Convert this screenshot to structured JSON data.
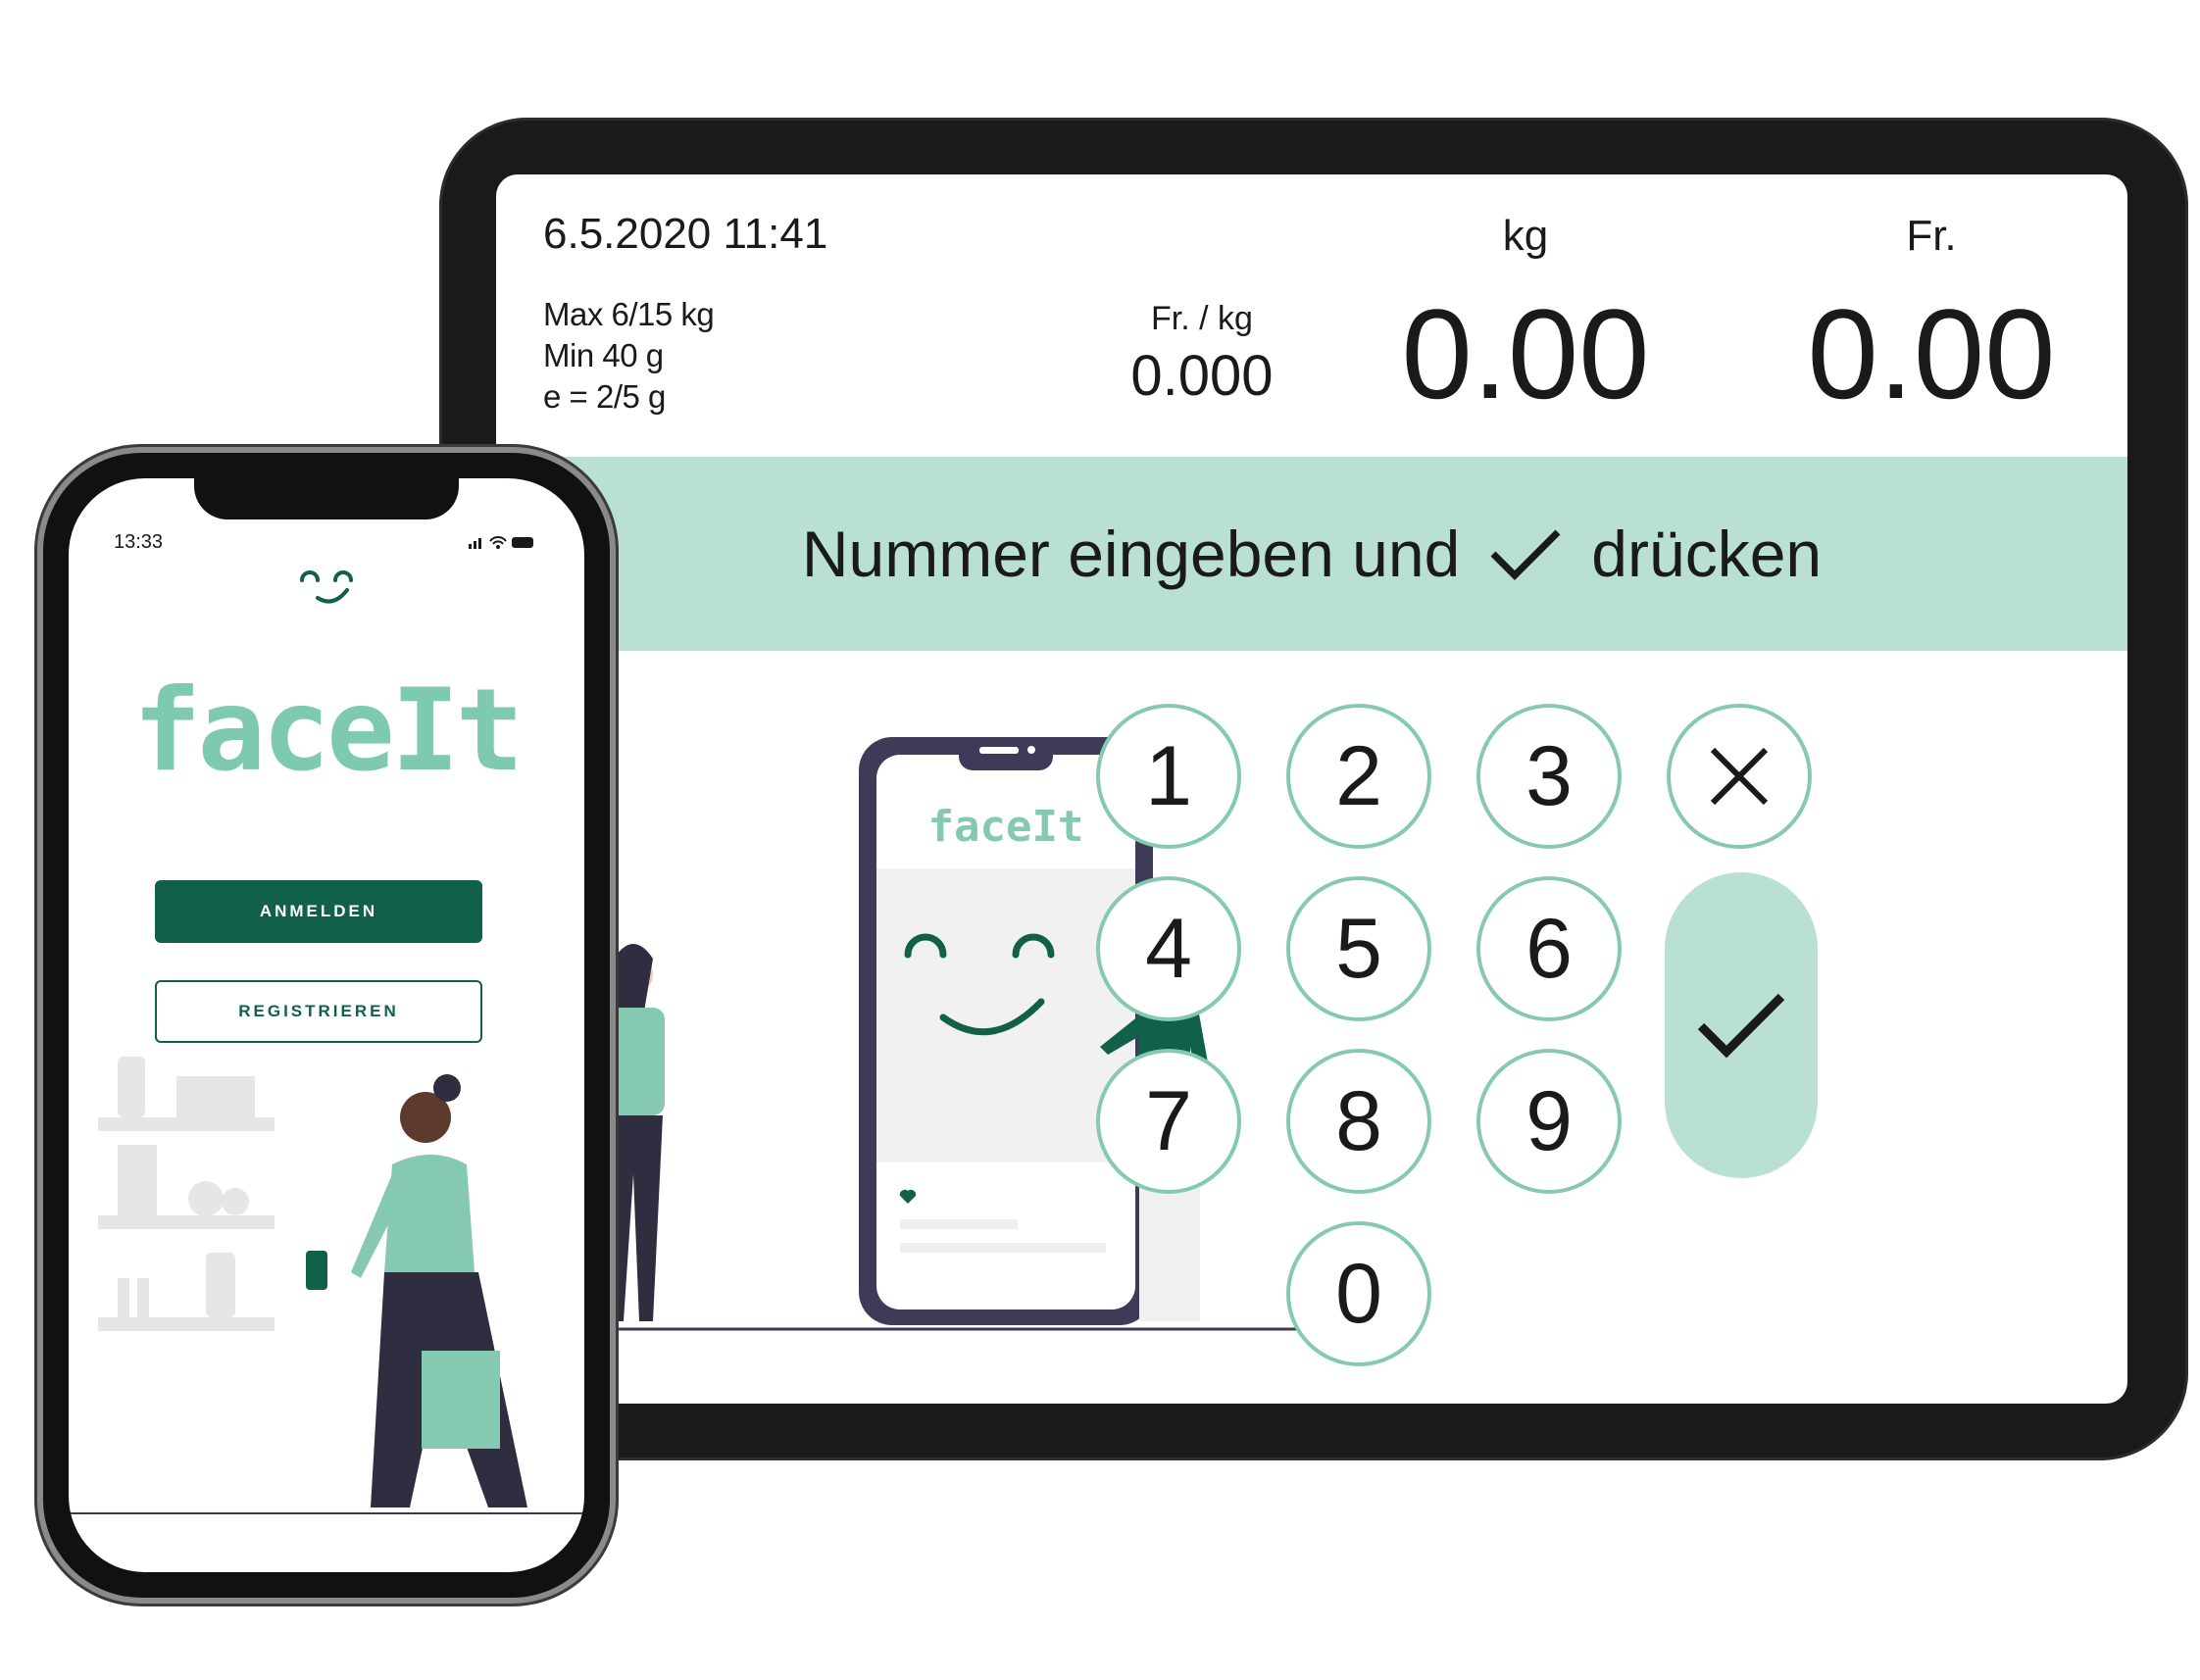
{
  "tablet": {
    "datetime": "6.5.2020 11:41",
    "specs": [
      "Max 6/15 kg",
      "Min 40 g",
      "e = 2/5 g"
    ],
    "price_per_kg_label": "Fr. / kg",
    "price_per_kg_value": "0.000",
    "weight_label": "kg",
    "weight_value": "0.00",
    "total_label": "Fr.",
    "total_value": "0.00",
    "instruction_before": "Nummer eingeben und",
    "instruction_after": "drücken",
    "keypad": [
      "1",
      "2",
      "3",
      "4",
      "5",
      "6",
      "7",
      "8",
      "9",
      "0"
    ],
    "illustration_logo": "faceIt",
    "accent": "#86c9b1",
    "banner_color": "#b9e0d2"
  },
  "phone": {
    "time": "13:33",
    "logo": "faceIt",
    "login_label": "ANMELDEN",
    "register_label": "REGISTRIEREN",
    "brand_dark": "#11604a",
    "brand_light": "#7ecaae"
  }
}
